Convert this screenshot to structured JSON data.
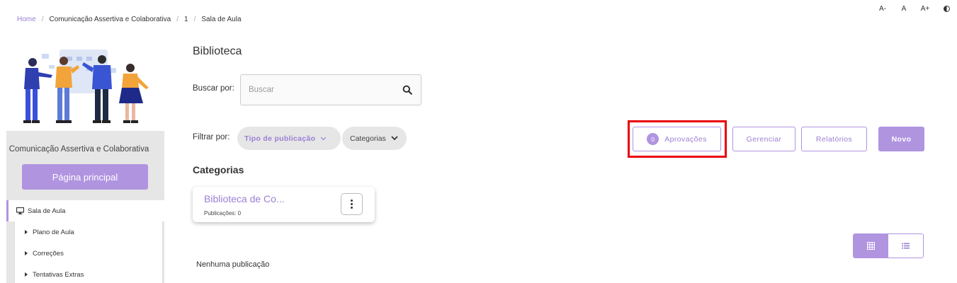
{
  "breadcrumb": {
    "home": "Home",
    "course": "Comunicação Assertiva e Colaborativa",
    "number": "1",
    "current": "Sala de Aula",
    "separator": "/"
  },
  "accessibility": {
    "decrease": "A-",
    "normal": "A",
    "increase": "A+",
    "contrast_icon": "contrast-icon"
  },
  "sidebar": {
    "course_name": "Comunicação Assertiva e Colaborativa",
    "main_page_button": "Página principal",
    "menu_main": "Sala de Aula",
    "menu_main_icon": "monitor-icon",
    "submenu": [
      {
        "label": "Plano de Aula"
      },
      {
        "label": "Correções"
      },
      {
        "label": "Tentativas Extras"
      }
    ]
  },
  "main": {
    "title": "Biblioteca",
    "search_label": "Buscar por:",
    "search_placeholder": "Buscar",
    "filter_label": "Filtrar por:",
    "filter_type": "Tipo de publicação",
    "filter_categories": "Categorias",
    "approvals_count": "0",
    "approvals_label": "Aprovações",
    "manage_label": "Gerenciar",
    "reports_label": "Relatórios",
    "new_label": "Novo",
    "categories_title": "Categorias",
    "category_card": {
      "title": "Biblioteca de Co...",
      "publications": "Publicações: 0"
    },
    "empty_message": "Nenhuma publicação"
  },
  "colors": {
    "accent": "#b094e0",
    "accent_text": "#9b7fd4",
    "highlight": "#e8000b",
    "panel": "#e6e6e6"
  }
}
